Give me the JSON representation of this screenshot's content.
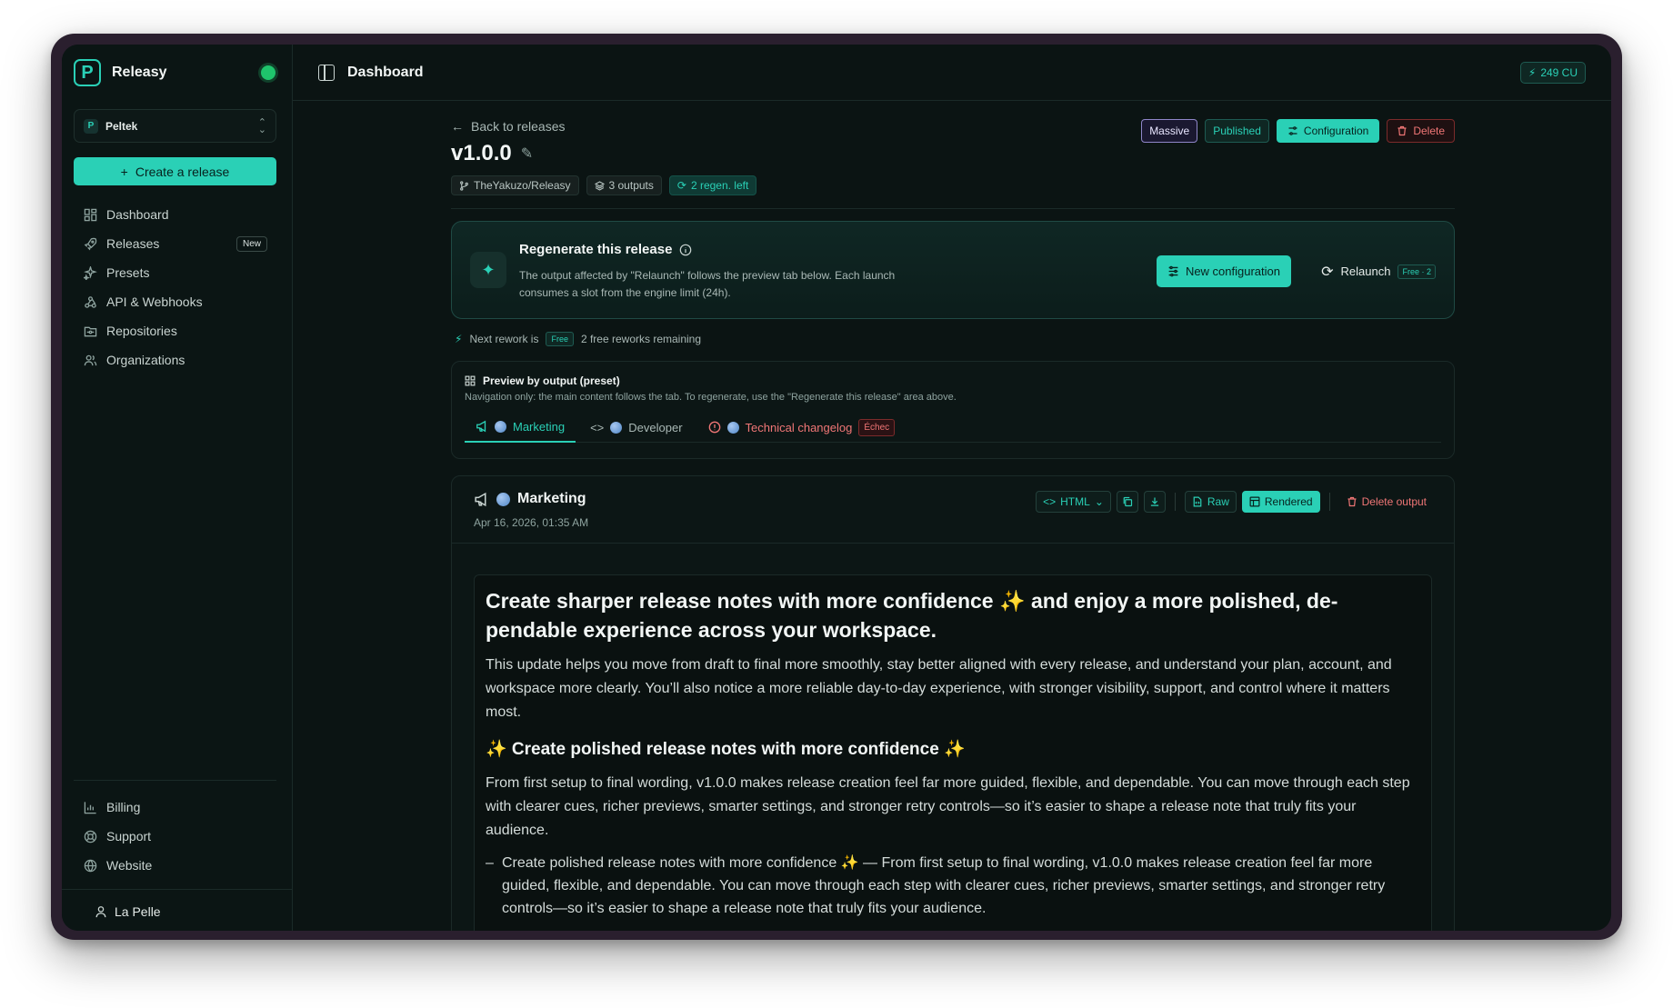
{
  "sidebar": {
    "brand": "Releasy",
    "brand_logo": "P",
    "org": {
      "initial": "P",
      "name": "Peltek"
    },
    "create_button": "Create a release",
    "nav": [
      {
        "label": "Dashboard",
        "icon": "dashboard-icon"
      },
      {
        "label": "Releases",
        "icon": "rocket-icon",
        "badge": "New"
      },
      {
        "label": "Presets",
        "icon": "sparkles-icon"
      },
      {
        "label": "API & Webhooks",
        "icon": "webhook-icon"
      },
      {
        "label": "Repositories",
        "icon": "folder-git-icon"
      },
      {
        "label": "Organizations",
        "icon": "users-icon"
      }
    ],
    "bottom_nav": [
      {
        "label": "Billing",
        "icon": "bar-chart-icon"
      },
      {
        "label": "Support",
        "icon": "lifebuoy-icon"
      },
      {
        "label": "Website",
        "icon": "globe-icon"
      }
    ],
    "user": "La Pelle"
  },
  "topbar": {
    "title": "Dashboard",
    "credits": "249 CU"
  },
  "release": {
    "back": "Back to releases",
    "version": "v1.0.0",
    "chips": [
      "TheYakuzo/Releasy",
      "3 outputs",
      "2 regen. left"
    ],
    "tags": {
      "massive": "Massive",
      "published": "Published",
      "configuration": "Configuration",
      "delete": "Delete"
    }
  },
  "regen": {
    "title": "Regenerate this release",
    "description": "The output affected by \"Relaunch\" follows the preview tab below. Each launch consumes a slot from the engine limit (24h).",
    "new_config": "New configuration",
    "relaunch": "Relaunch",
    "relaunch_badge": "Free · 2"
  },
  "rework": {
    "prefix": "Next rework is",
    "badge": "Free",
    "remaining": "2 free reworks remaining"
  },
  "preview": {
    "title": "Preview by output (preset)",
    "description": "Navigation only: the main content follows the tab. To regenerate, use the \"Regenerate this release\" area above.",
    "tabs": [
      {
        "label": "Marketing",
        "state": "active"
      },
      {
        "label": "Developer",
        "state": "normal"
      },
      {
        "label": "Technical changelog",
        "state": "error",
        "badge": "Échec"
      }
    ]
  },
  "output": {
    "title": "Marketing",
    "date": "Apr 16, 2026, 01:35 AM",
    "format": "HTML",
    "raw": "Raw",
    "rendered": "Rendered",
    "delete": "Delete output"
  },
  "doc": {
    "h1": "Create sharper release notes with more confidence ✨ and enjoy a more polished, de­pendable experience across your workspace.",
    "p1": "This update helps you move from draft to final more smoothly, stay better aligned with every release, and understand your plan, account, and workspace more clearly. You’ll also notice a more reliable day-to-day experience, with stronger visibility, support, and control where it matters most.",
    "h2": "✨ Create polished release notes with more confidence ✨",
    "p2": "From first setup to final wording, v1.0.0 makes release creation feel far more guided, flexible, and dependable. You can move through each step with clearer cues, richer previews, smarter settings, and stronger retry controls—so it’s easier to shape a release note that truly fits your audience.",
    "li1": "Create polished release notes with more confidence ✨ — From first setup to final wording, v1.0.0 makes release creation feel far more guided, flexible, and dependable. You can move through each step with clearer cues, richer previews, smarter settings, and stronger retry controls—so it’s easier to shape a release note that truly fits your audience."
  },
  "colors": {
    "accent": "#2ad0b6",
    "danger": "#f07676",
    "background": "#0b1413"
  }
}
